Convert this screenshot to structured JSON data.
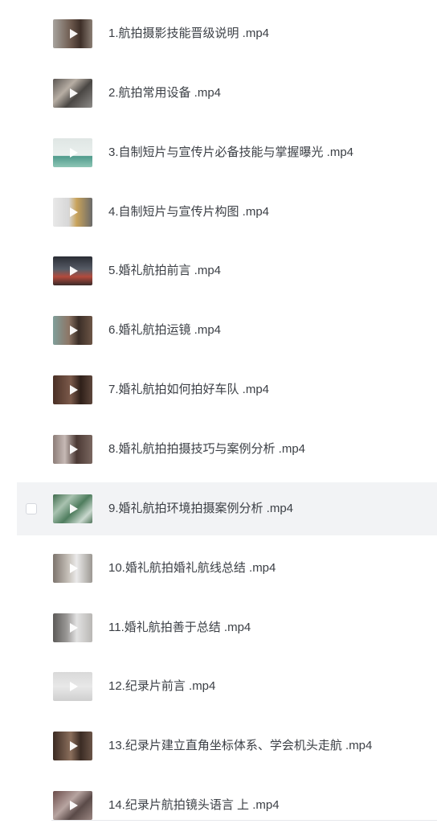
{
  "files": [
    {
      "name": "1.航拍摄影技能晋级说明 .mp4",
      "thumb": "linear-gradient(90deg,#a7a39e 0%,#6d5a4e 45%,#3e2f28 70%,#8a7e74 100%)"
    },
    {
      "name": "2.航拍常用设备 .mp4",
      "thumb": "linear-gradient(135deg,#5b5652 0%,#b7aea4 35%,#4a4744 60%,#8d8b88 100%)"
    },
    {
      "name": "3.自制短片与宣传片必备技能与掌握曝光 .mp4",
      "thumb": "linear-gradient(180deg,#dfe6e4 0%,#eaf0ee 60%,#4f9b8c 62%,#8ec6b6 100%)"
    },
    {
      "name": "4.自制短片与宣传片构图 .mp4",
      "thumb": "linear-gradient(90deg,#e8e8e8 0%,#d7d7d7 40%,#c9a35a 60%,#6a6a6a 100%)"
    },
    {
      "name": "5.婚礼航拍前言 .mp4",
      "thumb": "linear-gradient(180deg,#2a2d35 0%,#575c66 45%,#b24a3d 70%,#3a2a28 100%)"
    },
    {
      "name": "6.婚礼航拍运镜 .mp4",
      "thumb": "linear-gradient(90deg,#7f9e9a 0%,#8d7666 40%,#3b2e27 65%,#6c5546 100%)"
    },
    {
      "name": "7.婚礼航拍如何拍好车队 .mp4",
      "thumb": "linear-gradient(90deg,#4a2f25 0%,#7b5a4b 45%,#2e1f19 70%,#5d463b 100%)"
    },
    {
      "name": "8.婚礼航拍拍摄技巧与案例分析 .mp4",
      "thumb": "linear-gradient(90deg,#8c7d78 0%,#c6b9b5 30%,#4b3934 60%,#7a6760 100%)"
    },
    {
      "name": "9.婚礼航拍环境拍摄案例分析 .mp4",
      "thumb": "linear-gradient(135deg,#3f6b4c 0%,#a9c2b0 30%,#4f7d5e 55%,#c9d8ce 80%,#50755a 100%)",
      "highlighted": true
    },
    {
      "name": "10.婚礼航拍婚礼航线总结 .mp4",
      "thumb": "linear-gradient(90deg,#7d746d 0%,#c8c2bb 40%,#eaeaea 60%,#9c9892 100%)"
    },
    {
      "name": "11.婚礼航拍善于总结 .mp4",
      "thumb": "linear-gradient(90deg,#5c5a58 0%,#9a9896 35%,#e2e2e2 60%,#b9b7b4 100%)"
    },
    {
      "name": "12.纪录片前言 .mp4",
      "thumb": "linear-gradient(180deg,#d9d9d9 0%,#e8e8e8 50%,#cfcfcf 100%)"
    },
    {
      "name": "13.纪录片建立直角坐标体系、学会机头走航 .mp4",
      "thumb": "linear-gradient(90deg,#3b2a22 0%,#8b6f5c 45%,#3a2b24 70%,#6a5447 100%)"
    },
    {
      "name": "14.纪录片航拍镜头语言 上 .mp4",
      "thumb": "linear-gradient(135deg,#6b4c4a 0%,#b7a4a0 40%,#5a4a48 65%,#9a8682 100%)"
    }
  ]
}
